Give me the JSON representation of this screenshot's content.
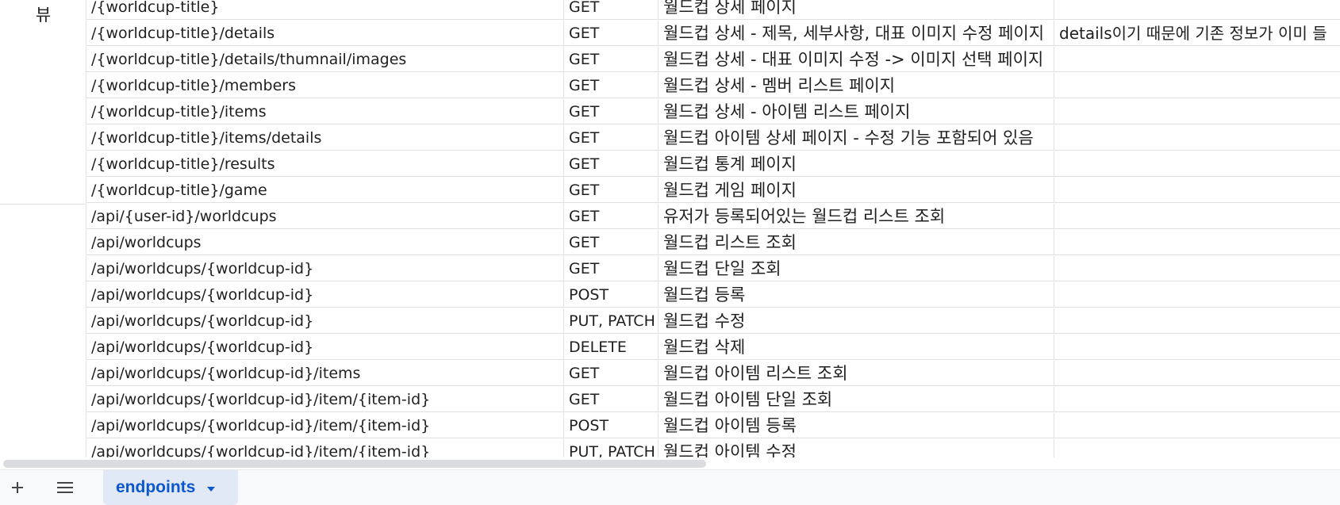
{
  "sheet": {
    "group_label_views": "뷰",
    "rows": [
      {
        "path": "/{worldcup-title}",
        "method": "GET",
        "description": "월드컵 상세 페이지",
        "note": ""
      },
      {
        "path": "/{worldcup-title}/details",
        "method": "GET",
        "description": "월드컵 상세 - 제목, 세부사항, 대표 이미지 수정 페이지",
        "note": "details이기 때문에 기존 정보가 이미 들"
      },
      {
        "path": "/{worldcup-title}/details/thumnail/images",
        "method": "GET",
        "description": "월드컵 상세 - 대표 이미지 수정 -> 이미지 선택 페이지",
        "note": ""
      },
      {
        "path": "/{worldcup-title}/members",
        "method": "GET",
        "description": "월드컵 상세 - 멤버 리스트 페이지",
        "note": ""
      },
      {
        "path": "/{worldcup-title}/items",
        "method": "GET",
        "description": "월드컵 상세 - 아이템 리스트 페이지",
        "note": ""
      },
      {
        "path": "/{worldcup-title}/items/details",
        "method": "GET",
        "description": "월드컵 아이템 상세 페이지 - 수정 기능 포함되어 있음",
        "note": ""
      },
      {
        "path": "/{worldcup-title}/results",
        "method": "GET",
        "description": "월드컵 통계 페이지",
        "note": ""
      },
      {
        "path": "/{worldcup-title}/game",
        "method": "GET",
        "description": "월드컵 게임 페이지",
        "note": ""
      },
      {
        "path": "/api/{user-id}/worldcups",
        "method": "GET",
        "description": "유저가 등록되어있는 월드컵 리스트 조회",
        "note": ""
      },
      {
        "path": "/api/worldcups",
        "method": "GET",
        "description": "월드컵 리스트 조회",
        "note": ""
      },
      {
        "path": "/api/worldcups/{worldcup-id}",
        "method": "GET",
        "description": "월드컵 단일 조회",
        "note": ""
      },
      {
        "path": "/api/worldcups/{worldcup-id}",
        "method": "POST",
        "description": "월드컵 등록",
        "note": ""
      },
      {
        "path": "/api/worldcups/{worldcup-id}",
        "method": "PUT, PATCH",
        "description": "월드컵 수정",
        "note": ""
      },
      {
        "path": "/api/worldcups/{worldcup-id}",
        "method": "DELETE",
        "description": "월드컵 삭제",
        "note": ""
      },
      {
        "path": "/api/worldcups/{worldcup-id}/items",
        "method": "GET",
        "description": "월드컵 아이템 리스트 조회",
        "note": ""
      },
      {
        "path": "/api/worldcups/{worldcup-id}/item/{item-id}",
        "method": "GET",
        "description": "월드컵 아이템 단일 조회",
        "note": ""
      },
      {
        "path": "/api/worldcups/{worldcup-id}/item/{item-id}",
        "method": "POST",
        "description": "월드컵 아이템 등록",
        "note": ""
      },
      {
        "path": "/api/worldcups/{worldcup-id}/item/{item-id}",
        "method": "PUT, PATCH",
        "description": "월드컵 아이템 수정",
        "note": ""
      }
    ]
  },
  "sheet_bar": {
    "add_sheet_icon": "plus-icon",
    "all_sheets_icon": "menu-icon",
    "active_tab_label": "endpoints",
    "tab_caret_icon": "caret-down-icon",
    "accent_color": "#0b57d0"
  }
}
